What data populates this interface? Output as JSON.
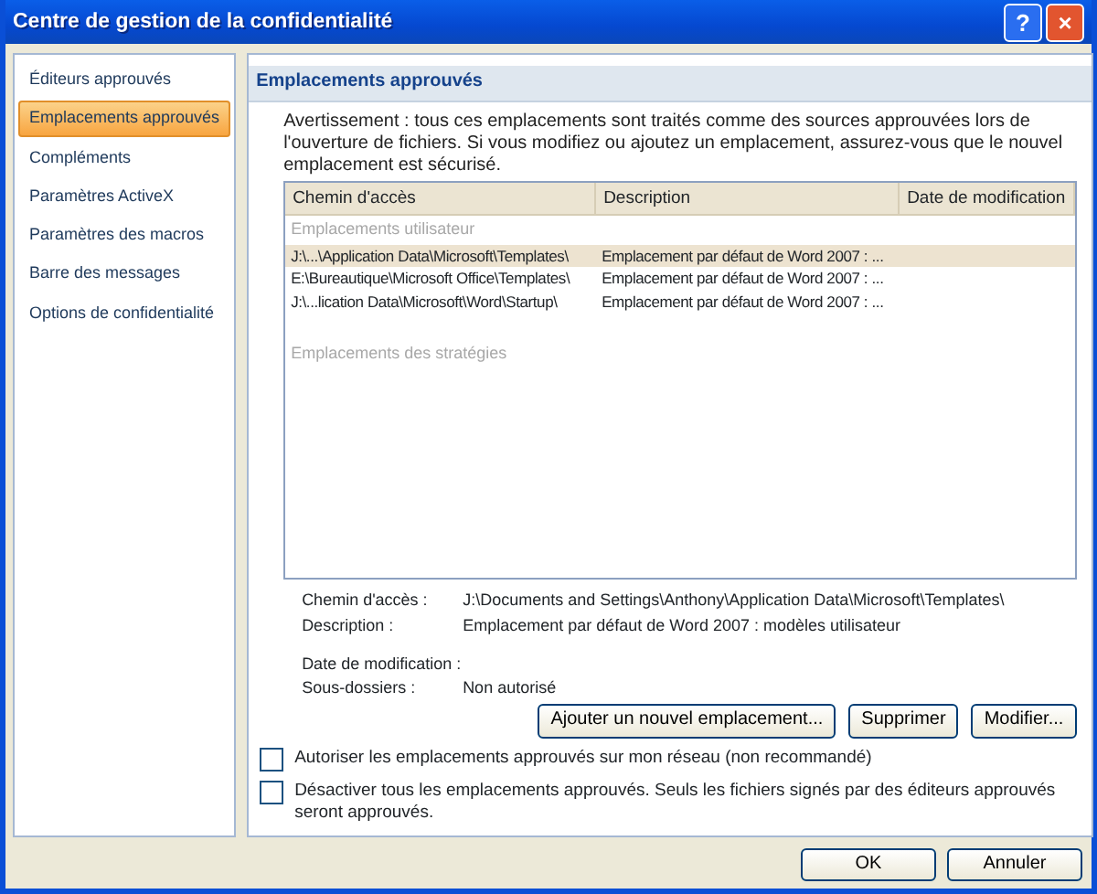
{
  "window": {
    "title": "Centre de gestion de la confidentialité",
    "buttons": [
      "?",
      "×"
    ]
  },
  "sidebar": {
    "items": [
      {
        "label": "Éditeurs approuvés",
        "selected": false
      },
      {
        "label": "Emplacements approuvés",
        "selected": true
      },
      {
        "label": "Compléments",
        "selected": false
      },
      {
        "label": "Paramètres ActiveX",
        "selected": false
      },
      {
        "label": "Paramètres des macros",
        "selected": false
      },
      {
        "label": "Barre des messages",
        "selected": false
      },
      {
        "label": "Options de confidentialité",
        "selected": false
      }
    ]
  },
  "section": {
    "title": "Emplacements approuvés",
    "warning": "Avertissement : tous ces emplacements sont traités comme des sources approuvées lors de l'ouverture de fichiers. Si vous modifiez ou ajoutez un emplacement, assurez-vous que le nouvel emplacement est sécurisé."
  },
  "list": {
    "columns": [
      "Chemin d'accès",
      "Description",
      "Date de modification"
    ],
    "groups": [
      {
        "label": "Emplacements utilisateur",
        "rows": [
          {
            "path": "J:\\...\\Application Data\\Microsoft\\Templates\\",
            "description": "Emplacement par défaut de Word 2007 : ...",
            "selected": true
          },
          {
            "path": "E:\\Bureautique\\Microsoft Office\\Templates\\",
            "description": "Emplacement par défaut de Word 2007 : ...",
            "selected": false
          },
          {
            "path": "J:\\...lication Data\\Microsoft\\Word\\Startup\\",
            "description": "Emplacement par défaut de Word 2007 : ...",
            "selected": false
          }
        ]
      },
      {
        "label": "Emplacements des stratégies"
      }
    ]
  },
  "details": [
    {
      "label": "Chemin d'accès :",
      "value": "J:\\Documents and Settings\\Anthony\\Application Data\\Microsoft\\Templates\\"
    },
    {
      "label": "Description :",
      "value": "Emplacement par défaut de Word 2007 : modèles utilisateur"
    },
    {
      "label": "Date de modification :"
    },
    {
      "label": "Sous-dossiers :",
      "value": "Non autorisé"
    }
  ],
  "actions": [
    "Ajouter un nouvel emplacement...",
    "Supprimer",
    "Modifier..."
  ],
  "checkboxes": [
    {
      "label": "Autoriser les emplacements approuvés sur mon réseau (non recommandé)",
      "checked": false
    },
    {
      "label": "Désactiver tous les emplacements approuvés. Seuls les fichiers signés par des éditeurs approuvés seront approuvés.",
      "checked": false
    }
  ],
  "footer_buttons": [
    "OK",
    "Annuler"
  ]
}
